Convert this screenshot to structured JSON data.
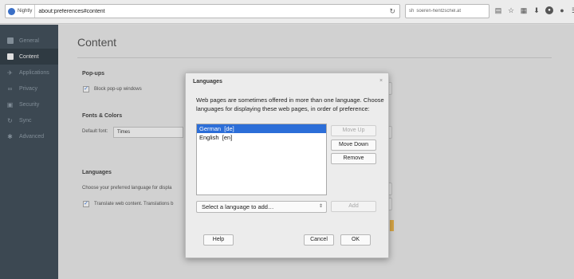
{
  "browser": {
    "brand_label": "Nightly",
    "url": "about:preferences#content",
    "search_text": "soeren-hentzschel.at",
    "search_engine_label": "sh"
  },
  "sidebar": {
    "items": [
      {
        "label": "General",
        "icon": "general-icon"
      },
      {
        "label": "Content",
        "icon": "content-icon",
        "selected": true
      },
      {
        "label": "Applications",
        "icon": "applications-icon"
      },
      {
        "label": "Privacy",
        "icon": "privacy-icon"
      },
      {
        "label": "Security",
        "icon": "security-icon"
      },
      {
        "label": "Sync",
        "icon": "sync-icon"
      },
      {
        "label": "Advanced",
        "icon": "advanced-icon"
      }
    ]
  },
  "main": {
    "title": "Content",
    "popups_heading": "Pop-ups",
    "block_popups_label": "Block pop-up windows",
    "fonts_heading": "Fonts & Colors",
    "default_font_label": "Default font:",
    "default_font_value": "Times",
    "languages_heading": "Languages",
    "languages_desc": "Choose your preferred language for displa",
    "translate_label": "Translate web content. Translations b"
  },
  "dialog": {
    "title": "Languages",
    "close_glyph": "×",
    "description": "Web pages are sometimes offered in more than one language. Choose languages for displaying these web pages, in order of preference:",
    "languages": [
      "German  [de]",
      "English  [en]"
    ],
    "selected_index": 0,
    "move_up_label": "Move Up",
    "move_down_label": "Move Down",
    "remove_label": "Remove",
    "select_placeholder": "Select a language to add…",
    "add_label": "Add",
    "help_label": "Help",
    "cancel_label": "Cancel",
    "ok_label": "OK"
  },
  "colors": {
    "sidebar_bg": "#424f5a",
    "selection": "#2c6ed8",
    "accent_bar": "#e6b24c"
  }
}
